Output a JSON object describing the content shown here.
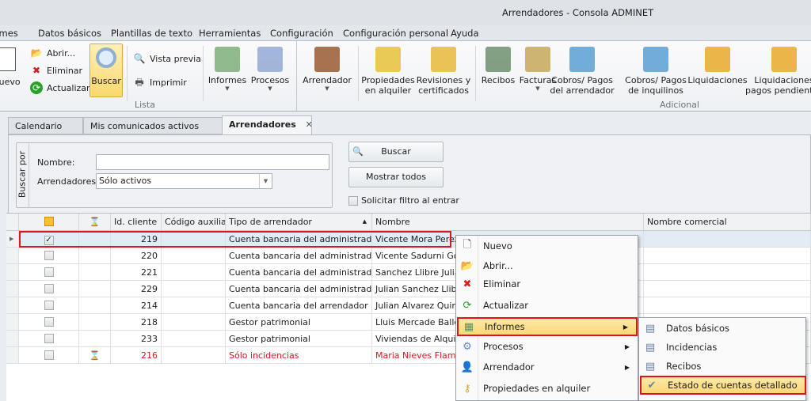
{
  "window": {
    "title": "Arrendadores - Consola ADMINET"
  },
  "menubar": [
    "rmes",
    "Datos básicos",
    "Plantillas de texto",
    "Herramientas",
    "Configuración",
    "Configuración personal",
    "Ayuda"
  ],
  "ribbon": {
    "nuevo": "Nuevo",
    "abrir": "Abrir...",
    "eliminar": "Eliminar",
    "actualizar": "Actualizar",
    "buscar": "Buscar",
    "vista_previa": "Vista previa",
    "imprimir": "Imprimir",
    "large": [
      {
        "l1": "Informes",
        "l2": "",
        "dd": true,
        "icon": "report-icon",
        "color": "#7fae7a"
      },
      {
        "l1": "Procesos",
        "l2": "",
        "dd": true,
        "icon": "gear-icon",
        "color": "#93a9d3"
      },
      {
        "l1": "Arrendador",
        "l2": "",
        "dd": true,
        "icon": "user-key-icon",
        "color": "#9a5a33"
      },
      {
        "l1": "Propiedades",
        "l2": "en alquiler",
        "dd": false,
        "icon": "key-icon",
        "color": "#e8c23a"
      },
      {
        "l1": "Revisiones y",
        "l2": "certificados",
        "dd": false,
        "icon": "bell-report-icon",
        "color": "#e8b83a"
      },
      {
        "l1": "Recibos",
        "l2": "",
        "dd": false,
        "icon": "receipt-icon",
        "color": "#6f8f6f"
      },
      {
        "l1": "Facturas",
        "l2": "",
        "dd": true,
        "icon": "invoice-icon",
        "color": "#c6a85a"
      },
      {
        "l1": "Cobros/ Pagos",
        "l2": "del arrendador",
        "dd": false,
        "icon": "calculator-icon",
        "color": "#5a9fd4"
      },
      {
        "l1": "Cobros/ Pagos",
        "l2": "de inquilinos",
        "dd": false,
        "icon": "calculator-user-icon",
        "color": "#5a9fd4"
      },
      {
        "l1": "Liquidaciones",
        "l2": "",
        "dd": false,
        "icon": "certificate-icon",
        "color": "#e9a92a"
      },
      {
        "l1": "Liquidaciones",
        "l2": "pagos pendientes",
        "dd": false,
        "icon": "certificate-icon",
        "color": "#e9a92a"
      }
    ],
    "group_lista": "Lista",
    "group_adicional": "Adicional"
  },
  "tabs": [
    {
      "label": "Calendario"
    },
    {
      "label": "Mis comunicados activos"
    },
    {
      "label": "Arrendadores",
      "close": "✕"
    }
  ],
  "search": {
    "group_label": "Buscar por",
    "nombre_label": "Nombre:",
    "nombre_value": "",
    "arrendadores_label": "Arrendadores:",
    "arrendadores_value": "Sólo activos",
    "buscar": "Buscar",
    "mostrar_todos": "Mostrar todos",
    "solicitar": "Solicitar filtro al entrar"
  },
  "grid": {
    "headers": [
      "Id. cliente",
      "Código auxiliar",
      "Tipo de arrendador",
      "Nombre",
      "Nombre comercial"
    ],
    "rows": [
      {
        "id": "219",
        "codigo": "",
        "tipo": "Cuenta bancaria del administrador",
        "nombre": "Vicente Mora Perez",
        "checked": true,
        "pending": false,
        "red": false
      },
      {
        "id": "220",
        "codigo": "",
        "tipo": "Cuenta bancaria del administrador",
        "nombre": "Vicente Sadurni Gonz",
        "checked": false,
        "pending": false,
        "red": false
      },
      {
        "id": "221",
        "codigo": "",
        "tipo": "Cuenta bancaria del administrador",
        "nombre": "Sanchez Llibre Julian",
        "checked": false,
        "pending": false,
        "red": false
      },
      {
        "id": "229",
        "codigo": "",
        "tipo": "Cuenta bancaria del administrador",
        "nombre": "Julian Sanchez Llibre",
        "checked": false,
        "pending": false,
        "red": false
      },
      {
        "id": "214",
        "codigo": "",
        "tipo": "Cuenta bancaria del arrendador",
        "nombre": "Julian Alvarez Quinte",
        "checked": false,
        "pending": false,
        "red": false
      },
      {
        "id": "218",
        "codigo": "",
        "tipo": "Gestor patrimonial",
        "nombre": "Lluis Mercade Ballesto",
        "checked": false,
        "pending": false,
        "red": false
      },
      {
        "id": "233",
        "codigo": "",
        "tipo": "Gestor patrimonial",
        "nombre": "Viviendas de Alquiler",
        "checked": false,
        "pending": false,
        "red": false
      },
      {
        "id": "216",
        "codigo": "",
        "tipo": "Sólo incidencias",
        "nombre": "Maria Nieves Flamerio",
        "checked": false,
        "pending": true,
        "red": true
      }
    ]
  },
  "context_menu": [
    {
      "label": "Nuevo",
      "icon": "new-document-icon",
      "glyph": "🗋",
      "color": "#333"
    },
    {
      "label": "Abrir...",
      "icon": "folder-icon",
      "glyph": "📂",
      "color": "#d9a520"
    },
    {
      "label": "Eliminar",
      "icon": "delete-icon",
      "glyph": "✖",
      "color": "#d42020"
    },
    {
      "label": "Actualizar",
      "icon": "refresh-icon",
      "glyph": "⟳",
      "color": "#2a9a2a"
    },
    {
      "label": "Informes",
      "icon": "report-icon",
      "glyph": "▦",
      "color": "#5f8f5f",
      "sub": true,
      "hl": true
    },
    {
      "label": "Procesos",
      "icon": "gear-icon",
      "glyph": "⚙",
      "color": "#6a86c0",
      "sub": true
    },
    {
      "label": "Arrendador",
      "icon": "user-key-icon",
      "glyph": "👤",
      "color": "#9a5a33",
      "sub": true
    },
    {
      "label": "Propiedades en alquiler",
      "icon": "key-icon",
      "glyph": "⚷",
      "color": "#d9a520"
    }
  ],
  "submenu": [
    {
      "label": "Datos básicos",
      "icon": "report-print-icon"
    },
    {
      "label": "Incidencias",
      "icon": "report-print-icon"
    },
    {
      "label": "Recibos",
      "icon": "receipt-icon"
    },
    {
      "label": "Estado de cuentas detallado",
      "icon": "certificate-icon",
      "hl": true
    }
  ]
}
